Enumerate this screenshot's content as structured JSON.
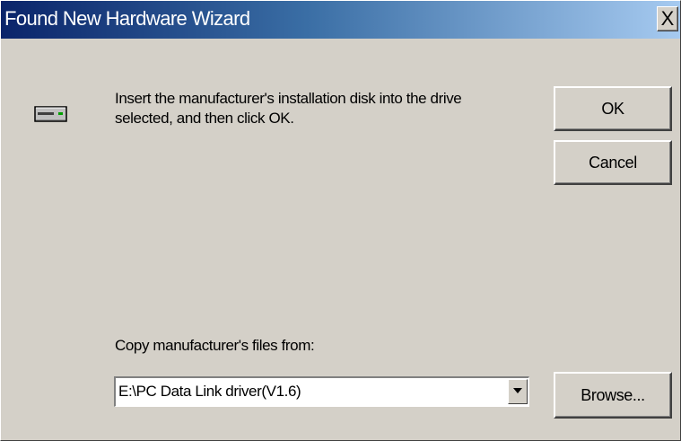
{
  "window": {
    "title": "Found New Hardware Wizard",
    "close_label": "X"
  },
  "message": "Insert the manufacturer's installation disk into the drive selected, and then click OK.",
  "buttons": {
    "ok": "OK",
    "cancel": "Cancel",
    "browse": "Browse..."
  },
  "copy_from": {
    "label": "Copy manufacturer's files from:",
    "value": "E:\\PC Data Link driver(V1.6)"
  },
  "icons": {
    "drive": "disk-drive-icon",
    "dropdown": "chevron-down-icon"
  },
  "colors": {
    "face": "#d4d0c8",
    "title_start": "#0a246a",
    "title_end": "#a6caf0"
  }
}
